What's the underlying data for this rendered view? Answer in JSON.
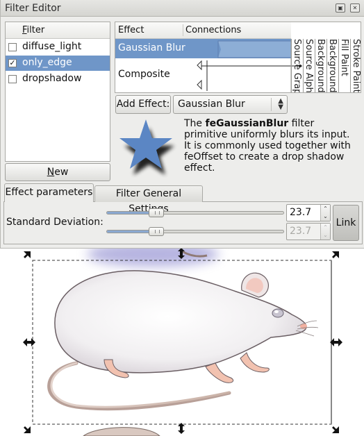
{
  "window": {
    "title": "Filter Editor"
  },
  "filters": {
    "header": "Filter",
    "items": [
      {
        "name": "diffuse_light",
        "checked": false,
        "selected": false
      },
      {
        "name": "only_edge",
        "checked": true,
        "selected": true
      },
      {
        "name": "dropshadow",
        "checked": false,
        "selected": false
      }
    ],
    "new_button": "New"
  },
  "effects": {
    "header_effect": "Effect",
    "header_connections": "Connections",
    "items": [
      {
        "name": "Gaussian Blur",
        "selected": true
      },
      {
        "name": "Composite",
        "selected": false
      }
    ],
    "inputs": [
      "Source Graphic",
      "Source Alpha",
      "Background Image",
      "Background Alpha",
      "Fill Paint",
      "Stroke Paint"
    ],
    "visible_inputs": [
      "Source Grap",
      "Source Alph",
      "Background",
      "Background",
      "Fill Paint",
      "Stroke Paint"
    ]
  },
  "add_effect": {
    "button": "Add Effect:",
    "selected": "Gaussian Blur"
  },
  "description": {
    "pre": "The ",
    "primitive": "feGaussianBlur",
    "post": " filter primitive uniformly blurs its input.  It is commonly used together with feOffset to create a drop shadow effect."
  },
  "tabs": [
    {
      "label": "Effect parameters",
      "active": true
    },
    {
      "label": "Filter General Settings",
      "active": false
    }
  ],
  "params": {
    "std_dev_label": "Standard Deviation:",
    "x_value": "23.7",
    "y_value": "23.7",
    "x_level": 0.26,
    "y_level": 0.26,
    "link_button": "Link"
  },
  "colors": {
    "selection": "#6f96c8",
    "star": "#5b86c4",
    "rat_body": "#f2f0f2",
    "rat_pink": "#f2c2b0"
  },
  "icons": {
    "titlebar_buttons": [
      "restore-icon",
      "close-icon"
    ],
    "illustration": "star-icon"
  }
}
